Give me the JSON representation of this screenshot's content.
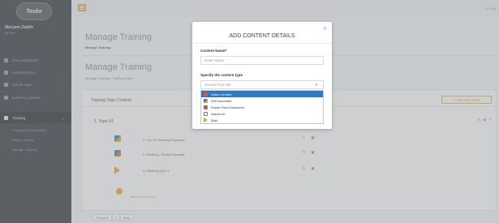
{
  "brand": {
    "logo_text": "Teske"
  },
  "user": {
    "name": "Maryam Zadeh",
    "role": "Ali Tele"
  },
  "sidebar": {
    "items": [
      {
        "label": "Kish Dashboard"
      },
      {
        "label": "Administration"
      },
      {
        "label": "Mobile Apps"
      },
      {
        "label": "Lessons Learned"
      },
      {
        "label": "Training"
      }
    ],
    "sub_items": [
      {
        "label": "Training Documentation"
      },
      {
        "label": "Assign Training"
      },
      {
        "label": "Manage Training"
      }
    ]
  },
  "header": {
    "logout_label": "Log"
  },
  "page": {
    "title_1": "Manage Training",
    "crumb_1": "Manage Training",
    "title_2": "Manage Training",
    "crumb_2": "Manage Training › Training Topic"
  },
  "panel": {
    "title": "Training Topic Content",
    "add_topic_label": "+ Add New Topic",
    "topic_name": "1. Topic 01",
    "items": [
      {
        "label": "1. Top 10 Phishing Examples"
      },
      {
        "label": "2. Phishing - Protect Yourself"
      },
      {
        "label": "3. Phishing Quiz 1"
      }
    ],
    "add_content_label": "Add New Content"
  },
  "pager": {
    "prev": "Previous",
    "page": "1",
    "next": "Next"
  },
  "modal": {
    "title": "ADD CONTENT DETAILS",
    "name_label": "Content Name*",
    "name_placeholder": "Enter Name",
    "type_label": "Specify the content type",
    "type_placeholder": "Choose from list",
    "options": [
      {
        "label": "Video Content"
      },
      {
        "label": "Pdf Document"
      },
      {
        "label": "Power Point Document"
      },
      {
        "label": "Hands-on"
      },
      {
        "label": "Quiz"
      }
    ]
  },
  "colors": {
    "accent": "#d7a531",
    "sidebar": "#2a3036",
    "selected": "#2e79c4",
    "delete": "#c23a2a"
  }
}
